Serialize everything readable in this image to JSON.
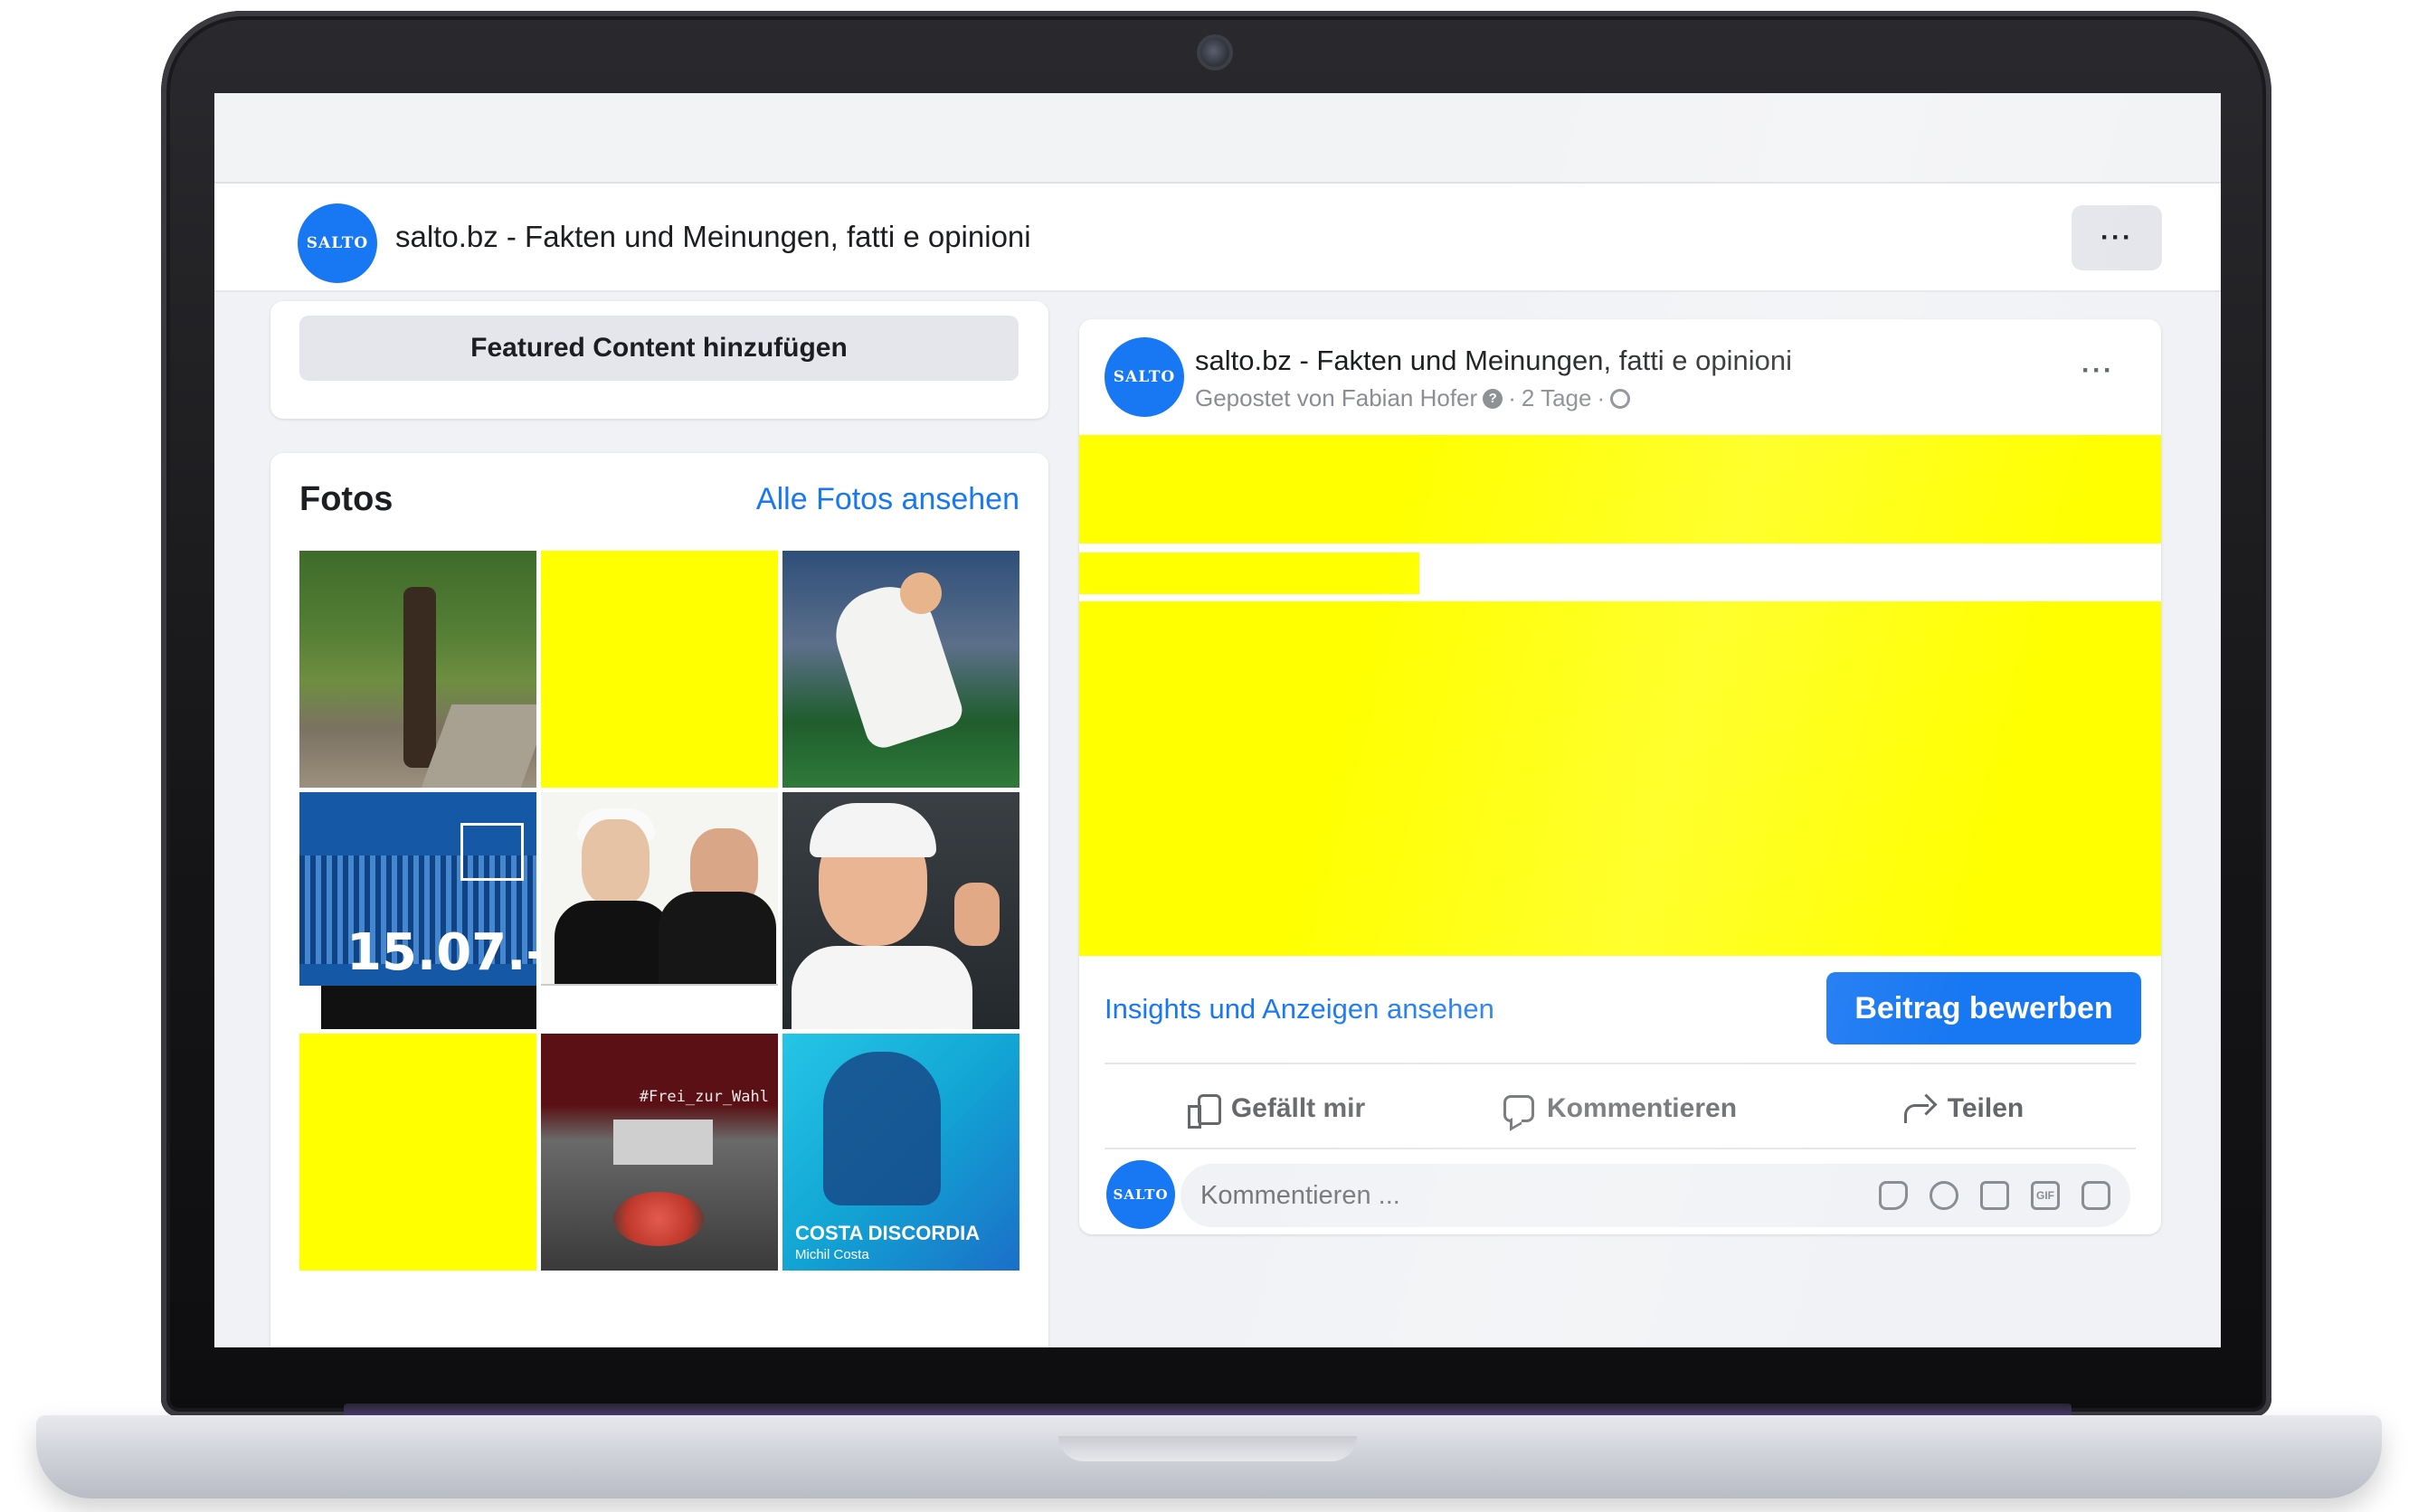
{
  "page": {
    "name": "salto.bz - Fakten und Meinungen, fatti e opinioni",
    "avatar_text": "SALTO",
    "more_label": "···"
  },
  "sidebar": {
    "featured_button": "Featured Content hinzufügen",
    "photos": {
      "title": "Fotos",
      "see_all": "Alle Fotos ansehen",
      "items": [
        {
          "kind": "photo",
          "subject": "tree"
        },
        {
          "kind": "redacted"
        },
        {
          "kind": "photo",
          "subject": "tennis-player-running"
        },
        {
          "kind": "photo",
          "subject": "culture-center-poster",
          "text": "15.07.-"
        },
        {
          "kind": "photo",
          "subject": "show-poster"
        },
        {
          "kind": "photo",
          "subject": "tennis-player-fist"
        },
        {
          "kind": "redacted"
        },
        {
          "kind": "photo",
          "subject": "frei-zur-wahl",
          "text": "#Frei_zur_Wahl"
        },
        {
          "kind": "photo",
          "subject": "costa-discordia",
          "title": "COSTA DISCORDIA",
          "subtitle": "Michil Costa"
        }
      ]
    }
  },
  "post": {
    "author": "salto.bz - Fakten und Meinungen, fatti e opinioni",
    "avatar_text": "SALTO",
    "meta": {
      "posted_by": "Gepostet von Fabian Hofer",
      "age": "2 Tage"
    },
    "more_label": "···",
    "insights_link": "Insights und Anzeigen ansehen",
    "boost_button": "Beitrag bewerben",
    "actions": {
      "like": "Gefällt mir",
      "comment": "Kommentieren",
      "share": "Teilen"
    },
    "comment": {
      "avatar_text": "SALTO",
      "placeholder": "Kommentieren ...",
      "gif_label": "GIF"
    }
  },
  "colors": {
    "brand_blue": "#1877f2",
    "redaction_yellow": "#ffff00",
    "background": "#f0f2f5"
  }
}
